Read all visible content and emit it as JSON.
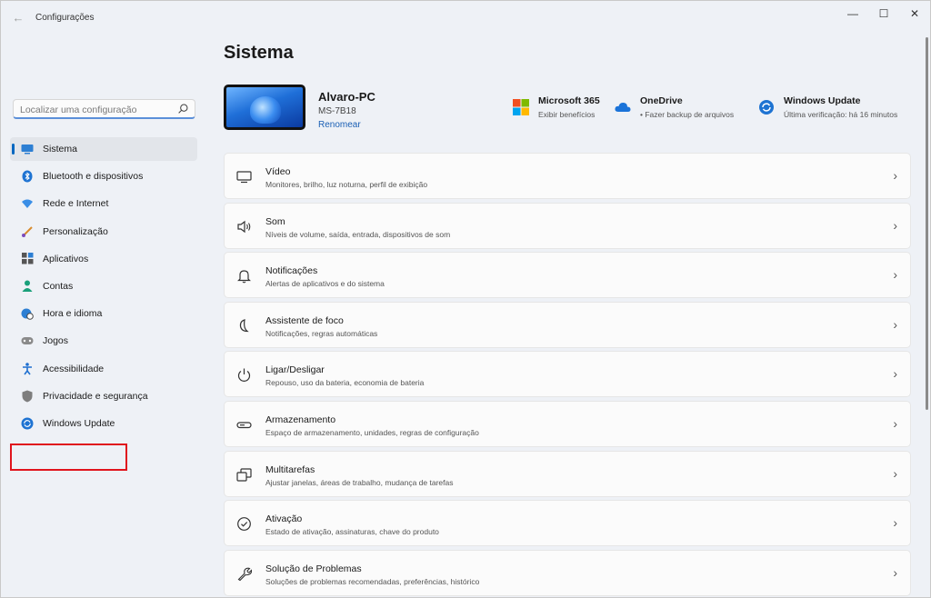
{
  "window": {
    "app_title": "Configurações",
    "back_glyph": "←",
    "minimize_glyph": "—",
    "maximize_glyph": "☐",
    "close_glyph": "✕"
  },
  "search": {
    "placeholder": "Localizar uma configuração",
    "icon": "search-icon"
  },
  "nav": {
    "items": [
      {
        "label": "Sistema",
        "icon": "monitor-icon",
        "selected": true
      },
      {
        "label": "Bluetooth e dispositivos",
        "icon": "bluetooth-icon"
      },
      {
        "label": "Rede e Internet",
        "icon": "wifi-icon"
      },
      {
        "label": "Personalização",
        "icon": "brush-icon"
      },
      {
        "label": "Aplicativos",
        "icon": "apps-icon"
      },
      {
        "label": "Contas",
        "icon": "person-icon"
      },
      {
        "label": "Hora e idioma",
        "icon": "globe-clock-icon"
      },
      {
        "label": "Jogos",
        "icon": "gamepad-icon"
      },
      {
        "label": "Acessibilidade",
        "icon": "accessibility-icon"
      },
      {
        "label": "Privacidade e segurança",
        "icon": "shield-icon"
      },
      {
        "label": "Windows Update",
        "icon": "windows-update-icon",
        "highlighted": true
      }
    ]
  },
  "main": {
    "title": "Sistema",
    "device": {
      "name": "Alvaro-PC",
      "model": "MS-7B18",
      "rename": "Renomear"
    },
    "quick": [
      {
        "title": "Microsoft 365",
        "sub": "Exibir benefícios",
        "icon": "microsoft-logo-icon"
      },
      {
        "title": "OneDrive",
        "sub": "• Fazer backup de arquivos",
        "icon": "cloud-icon"
      },
      {
        "title": "Windows Update",
        "sub": "Última verificação: há 16 minutos",
        "icon": "sync-icon"
      }
    ],
    "cards": [
      {
        "title": "Vídeo",
        "sub": "Monitores, brilho, luz noturna, perfil de exibição",
        "icon": "display-icon"
      },
      {
        "title": "Som",
        "sub": "Níveis de volume, saída, entrada, dispositivos de som",
        "icon": "speaker-icon"
      },
      {
        "title": "Notificações",
        "sub": "Alertas de aplicativos e do sistema",
        "icon": "bell-icon"
      },
      {
        "title": "Assistente de foco",
        "sub": "Notificações, regras automáticas",
        "icon": "moon-icon"
      },
      {
        "title": "Ligar/Desligar",
        "sub": "Repouso, uso da bateria, economia de bateria",
        "icon": "power-icon"
      },
      {
        "title": "Armazenamento",
        "sub": "Espaço de armazenamento, unidades, regras de configuração",
        "icon": "storage-icon"
      },
      {
        "title": "Multitarefas",
        "sub": "Ajustar janelas, áreas de trabalho, mudança de tarefas",
        "icon": "multitask-icon"
      },
      {
        "title": "Ativação",
        "sub": "Estado de ativação, assinaturas, chave do produto",
        "icon": "check-circle-icon"
      },
      {
        "title": "Solução de Problemas",
        "sub": "Soluções de problemas recomendadas, preferências, histórico",
        "icon": "wrench-icon"
      }
    ],
    "chevron": "›"
  },
  "colors": {
    "accent": "#0067c0",
    "highlight": "#e0141d"
  }
}
